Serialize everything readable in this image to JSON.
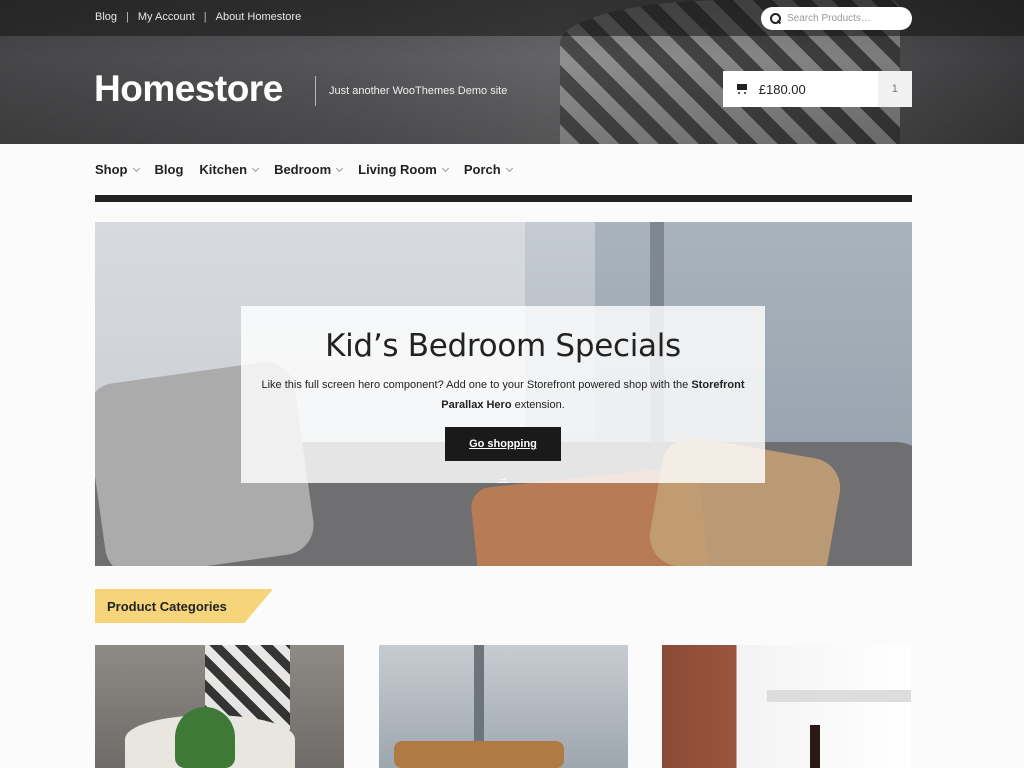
{
  "secondary_nav": {
    "items": [
      "Blog",
      "My Account",
      "About Homestore"
    ],
    "separator": "|"
  },
  "search": {
    "placeholder": "Search Products…",
    "icon": "search-icon"
  },
  "site": {
    "title": "Homestore",
    "tagline": "Just another WooThemes Demo site"
  },
  "cart": {
    "amount": "£180.00",
    "count": "1",
    "icon": "cart-icon"
  },
  "primary_nav": {
    "items": [
      {
        "label": "Shop",
        "has_submenu": true
      },
      {
        "label": "Blog",
        "has_submenu": false
      },
      {
        "label": "Kitchen",
        "has_submenu": true
      },
      {
        "label": "Bedroom",
        "has_submenu": true
      },
      {
        "label": "Living Room",
        "has_submenu": true
      },
      {
        "label": "Porch",
        "has_submenu": true
      }
    ]
  },
  "hero": {
    "title": "Kid’s Bedroom Specials",
    "text_before": "Like this full screen hero component? Add one to your Storefront powered shop with the ",
    "text_bold": "Storefront Parallax Hero",
    "text_after": " extension.",
    "button_label": "Go shopping →"
  },
  "section": {
    "title": "Product Categories",
    "accent_color": "#f5d47a"
  },
  "categories": {
    "count_visible": 3
  },
  "colors": {
    "topbar": "#2a2a2a",
    "nav_rule": "#222222",
    "button": "#1a1a1a"
  }
}
